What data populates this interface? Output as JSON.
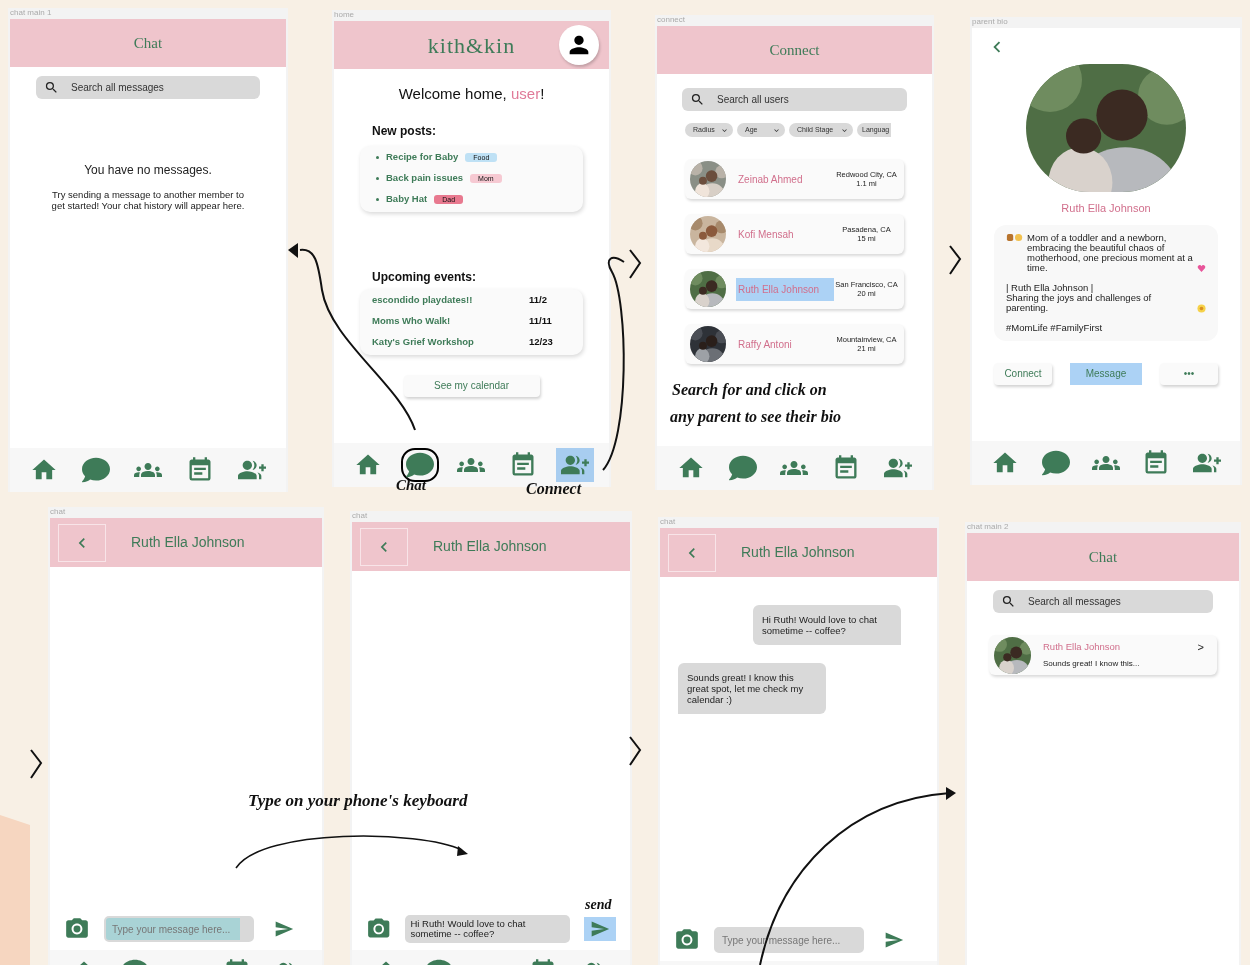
{
  "annotations": [
    {
      "text": "Chat"
    },
    {
      "text": "Connect"
    },
    {
      "text": "Search for and click on"
    },
    {
      "text": "any parent to see their bio"
    },
    {
      "text": "Type on your phone's keyboard"
    },
    {
      "text": "send"
    }
  ],
  "frames": [
    {
      "kind": "chat_list",
      "label": "chat main 1",
      "title": "Chat",
      "search": {
        "placeholder": "Search all messages"
      },
      "empty": {
        "heading": "You have no messages.",
        "body": "Try sending a message to another member to get started! Your chat history will appear here."
      }
    },
    {
      "kind": "home",
      "label": "home",
      "brand": "kith&kin",
      "welcome": {
        "before": "Welcome home, ",
        "name": "user",
        "after": "!"
      },
      "posts_heading": "New posts:",
      "posts": [
        {
          "title": "Recipe for Baby",
          "tag": "Food",
          "color": "#bfe1f5"
        },
        {
          "title": "Back pain issues",
          "tag": "Mom",
          "color": "#f6c9d2"
        },
        {
          "title": "Baby Hat",
          "tag": "Dad",
          "color": "#e8798f"
        }
      ],
      "events_heading": "Upcoming events:",
      "events": [
        {
          "name": "escondido playdates!!",
          "date": "11/2"
        },
        {
          "name": "Moms Who Walk!",
          "date": "11/11"
        },
        {
          "name": "Katy's Grief Workshop",
          "date": "12/23"
        }
      ],
      "calendar_button": "See my calendar",
      "nav": [
        {
          "circled": false,
          "highlighted": false
        },
        {
          "circled": true,
          "highlighted": false
        },
        {
          "circled": false,
          "highlighted": false
        },
        {
          "circled": false,
          "highlighted": false
        },
        {
          "circled": false,
          "highlighted": true
        }
      ]
    },
    {
      "kind": "connect",
      "label": "connect",
      "title": "Connect",
      "search": {
        "placeholder": "Search all users"
      },
      "filters": [
        {
          "label": "Radius",
          "dropdown": true
        },
        {
          "label": "Age",
          "dropdown": true
        },
        {
          "label": "Child Stage",
          "dropdown": true
        },
        {
          "label": "Languag",
          "dropdown": false
        }
      ],
      "users": [
        {
          "name": "Zeinab Ahmed",
          "location": "Redwood City, CA",
          "distance": "1.1 mi",
          "highlighted": false
        },
        {
          "name": "Kofi Mensah",
          "location": "Pasadena, CA",
          "distance": "15 mi",
          "highlighted": false
        },
        {
          "name": "Ruth Ella Johnson",
          "location": "San Francisco, CA",
          "distance": "20 mi",
          "highlighted": true
        },
        {
          "name": "Raffy Antoni",
          "location": "Mountainview, CA",
          "distance": "21 mi",
          "highlighted": false
        }
      ]
    },
    {
      "kind": "bio",
      "label": "parent bio",
      "name": "Ruth Ella Johnson",
      "bio": [
        {
          "text": "Mom of a toddler and a newborn, embracing the beautiful chaos of motherhood, one precious moment at a time.",
          "kind": "intro",
          "new_paragraph": false
        },
        {
          "text": "| Ruth Ella Johnson |",
          "kind": "plain",
          "new_paragraph": true
        },
        {
          "text": "Sharing the joys and challenges of parenting.",
          "kind": "flower",
          "new_paragraph": false
        },
        {
          "text": "#MomLife #FamilyFirst",
          "kind": "plain",
          "new_paragraph": true
        }
      ],
      "buttons": [
        {
          "label": "Connect",
          "highlighted": false
        },
        {
          "label": "Message",
          "highlighted": true
        },
        {
          "label": "•••",
          "highlighted": false
        }
      ]
    },
    {
      "kind": "conversation",
      "label": "chat",
      "title": "Ruth Ella Johnson",
      "input": {
        "placeholder": "Type your message here...",
        "highlighted": true
      },
      "send_highlighted": false
    },
    {
      "kind": "conversation",
      "label": "chat",
      "title": "Ruth Ella Johnson",
      "input": {
        "value": "Hi Ruth! Would love to chat sometime -- coffee?",
        "highlighted": false
      },
      "send_highlighted": true
    },
    {
      "kind": "conversation",
      "label": "chat",
      "title": "Ruth Ella Johnson",
      "messages": [
        {
          "text": "Hi Ruth! Would love to chat sometime -- coffee?",
          "sent": true
        },
        {
          "text": "Sounds great! I know this great spot, let me check my calendar :)",
          "sent": false
        }
      ],
      "input": {
        "placeholder": "Type your message here...",
        "highlighted": false
      },
      "send_highlighted": false
    },
    {
      "kind": "chat_list",
      "label": "chat main 2",
      "title": "Chat",
      "search": {
        "placeholder": "Search all messages"
      },
      "conversations": [
        {
          "name": "Ruth Ella Johnson",
          "preview": "Sounds great! I know this...",
          "arrow": ">"
        }
      ]
    }
  ]
}
